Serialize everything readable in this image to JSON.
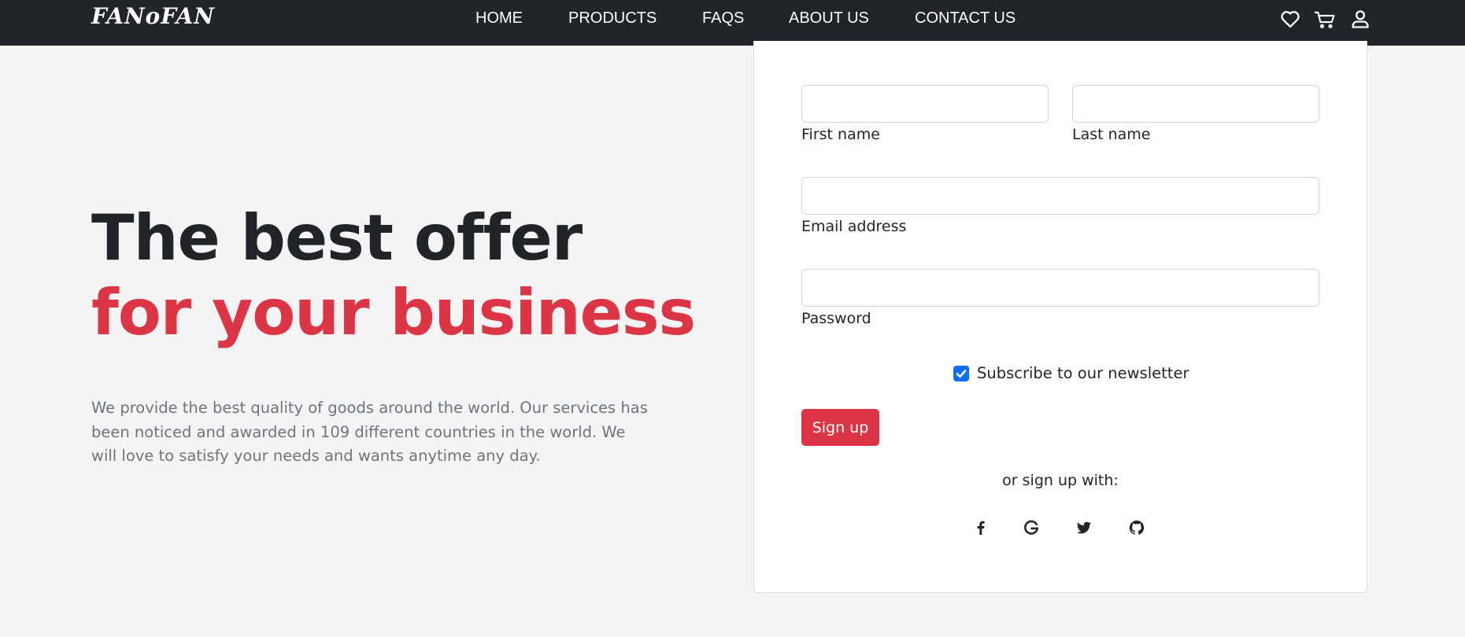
{
  "navbar": {
    "brand": "FANoFAN",
    "links": [
      "HOME",
      "PRODUCTS",
      "FAQS",
      "ABOUT US",
      "CONTACT US"
    ],
    "icons": [
      "heart-icon",
      "cart-icon",
      "user-icon"
    ]
  },
  "hero": {
    "headline_line1": "The best offer",
    "headline_line2": "for your business",
    "description": "We provide the best quality of goods around the world. Our services has been noticed and awarded in 109 different countries in the world. We will love to satisfy your needs and wants anytime any day."
  },
  "form": {
    "first_name": {
      "label": "First name",
      "value": ""
    },
    "last_name": {
      "label": "Last name",
      "value": ""
    },
    "email": {
      "label": "Email address",
      "value": ""
    },
    "password": {
      "label": "Password",
      "value": ""
    },
    "newsletter": {
      "label": "Subscribe to our newsletter",
      "checked": true
    },
    "submit_label": "Sign up",
    "alt_signup_text": "or sign up with:",
    "social_icons": [
      "facebook-icon",
      "google-icon",
      "twitter-icon",
      "github-icon"
    ]
  },
  "colors": {
    "navbar_bg": "#212529",
    "accent": "#dc3545",
    "checkbox": "#0d6efd",
    "page_bg": "#f4f4f4"
  }
}
